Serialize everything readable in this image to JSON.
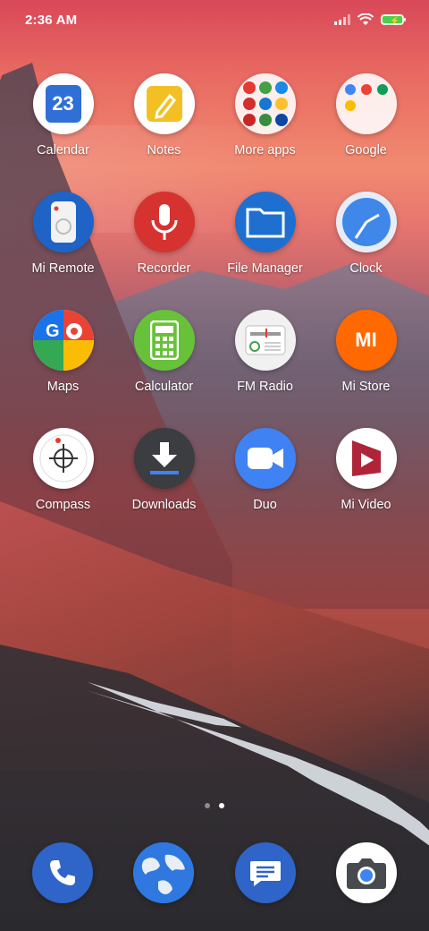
{
  "status_bar": {
    "time": "2:36 AM"
  },
  "apps": [
    {
      "id": "calendar",
      "label": "Calendar",
      "icon": "calendar-icon",
      "badge_text": "23"
    },
    {
      "id": "notes",
      "label": "Notes",
      "icon": "notes-icon"
    },
    {
      "id": "more-apps",
      "label": "More apps",
      "icon": "folder-icon"
    },
    {
      "id": "google",
      "label": "Google",
      "icon": "google-folder-icon"
    },
    {
      "id": "mi-remote",
      "label": "Mi Remote",
      "icon": "remote-icon"
    },
    {
      "id": "recorder",
      "label": "Recorder",
      "icon": "microphone-icon"
    },
    {
      "id": "file-manager",
      "label": "File Manager",
      "icon": "folder-file-icon"
    },
    {
      "id": "clock",
      "label": "Clock",
      "icon": "clock-icon"
    },
    {
      "id": "maps",
      "label": "Maps",
      "icon": "maps-icon"
    },
    {
      "id": "calculator",
      "label": "Calculator",
      "icon": "calculator-icon"
    },
    {
      "id": "fm-radio",
      "label": "FM Radio",
      "icon": "radio-icon"
    },
    {
      "id": "mi-store",
      "label": "Mi Store",
      "icon": "mi-logo-icon",
      "badge_text": "MI"
    },
    {
      "id": "compass",
      "label": "Compass",
      "icon": "compass-icon"
    },
    {
      "id": "downloads",
      "label": "Downloads",
      "icon": "download-icon"
    },
    {
      "id": "duo",
      "label": "Duo",
      "icon": "video-camera-icon"
    },
    {
      "id": "mi-video",
      "label": "Mi Video",
      "icon": "play-film-icon"
    }
  ],
  "pager": {
    "pages": 2,
    "active_index": 1
  },
  "dock": [
    {
      "id": "phone",
      "icon": "phone-icon"
    },
    {
      "id": "browser",
      "icon": "globe-icon"
    },
    {
      "id": "messages",
      "icon": "message-icon"
    },
    {
      "id": "camera",
      "icon": "camera-icon"
    }
  ],
  "colors": {
    "calendar_blue": "#2f6fd6",
    "notes_yellow": "#f3c024",
    "recorder_red": "#d6322f",
    "file_blue": "#1e6fd0",
    "calculator_green": "#67c23a",
    "mi_orange": "#ff6900",
    "downloads_dark": "#3b3d40",
    "duo_blue": "#3f82f3",
    "dock_blue": "#2f64c8"
  }
}
